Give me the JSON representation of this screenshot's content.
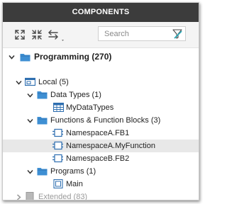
{
  "header": {
    "title": "COMPONENTS"
  },
  "toolbar": {
    "expand_all_icon": "expand-all-icon",
    "collapse_all_icon": "collapse-all-icon",
    "sort_icon": "sort-icon",
    "search_placeholder": "Search",
    "filter_icon": "filter-icon"
  },
  "tree": {
    "root": {
      "label": "Programming (270)",
      "expanded": true
    },
    "local": {
      "label": "Local (5)",
      "expanded": true
    },
    "data_types": {
      "label": "Data Types (1)",
      "expanded": true
    },
    "my_data_types": {
      "label": "MyDataTypes"
    },
    "functions": {
      "label": "Functions & Function Blocks (3)",
      "expanded": true
    },
    "fb1": {
      "label": "NamespaceA.FB1"
    },
    "my_function": {
      "label": "NamespaceA.MyFunction",
      "selected": true
    },
    "fb2": {
      "label": "NamespaceB.FB2"
    },
    "programs": {
      "label": "Programs (1)",
      "expanded": true
    },
    "main": {
      "label": "Main"
    },
    "extended": {
      "label": "Extended (83)",
      "expanded": false
    }
  },
  "colors": {
    "header_bg": "#3c3c3c",
    "folder": "#3e8fd3",
    "icon_stroke": "#2f6fb0",
    "selection": "#e8e8e8",
    "filter_accent": "#2aa7b5"
  }
}
